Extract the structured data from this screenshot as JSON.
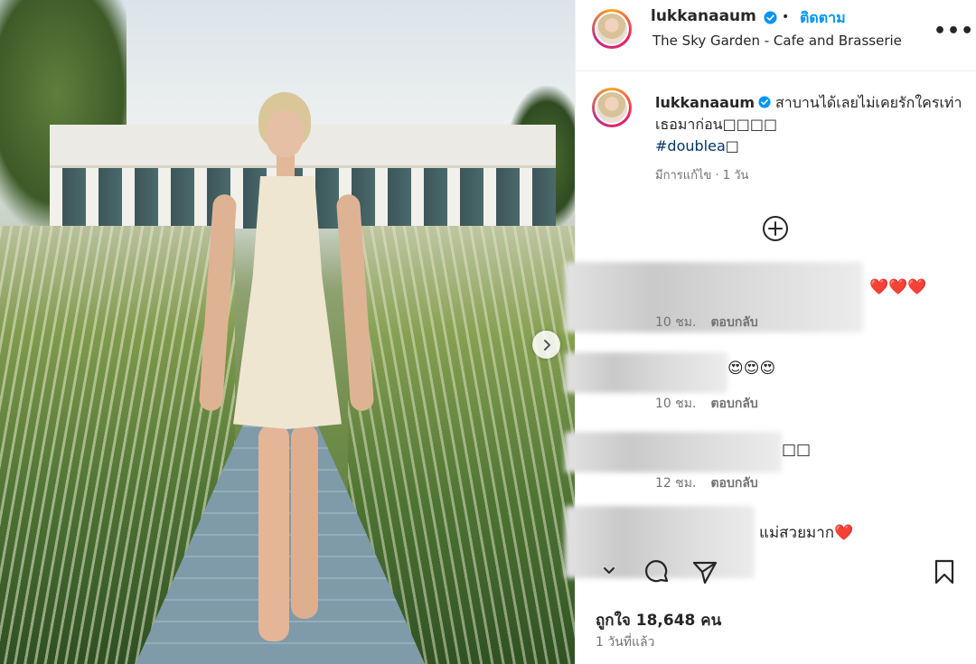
{
  "post": {
    "user": "lukkanaaum",
    "follow_label": "ติดตาม",
    "separator": "•",
    "location": "The Sky Garden - Cafe and Brasserie",
    "more_label": "•••"
  },
  "caption": {
    "user": "lukkanaaum",
    "text": "สาบานได้เลยไม่เคยรักใครเท่าเธอมาก่อน□□□□",
    "hashtag": "#doublea",
    "hashtag_suffix": "□",
    "meta": "มีการแก้ไข · 1 วัน"
  },
  "comments": [
    {
      "text": "❤️❤️❤️",
      "time": "10 ชม.",
      "reply": "ตอบกลับ"
    },
    {
      "text": "😍😍😍",
      "time": "10 ชม.",
      "reply": "ตอบกลับ"
    },
    {
      "text": "□□",
      "time": "12 ชม.",
      "reply": "ตอบกลับ"
    },
    {
      "text": "แม่สวยมาก❤️"
    }
  ],
  "likes": "ถูกใจ 18,648 คน",
  "posted_ago": "1 วันที่แล้ว",
  "icons": {
    "verified": "verified-badge-icon",
    "add": "add-circle-icon",
    "next": "chevron-right-icon",
    "comment": "comment-icon",
    "share": "send-icon",
    "save": "bookmark-icon"
  },
  "colors": {
    "accent": "#0095f6",
    "verified": "#0095f6",
    "text": "#262626",
    "muted": "#737373"
  }
}
